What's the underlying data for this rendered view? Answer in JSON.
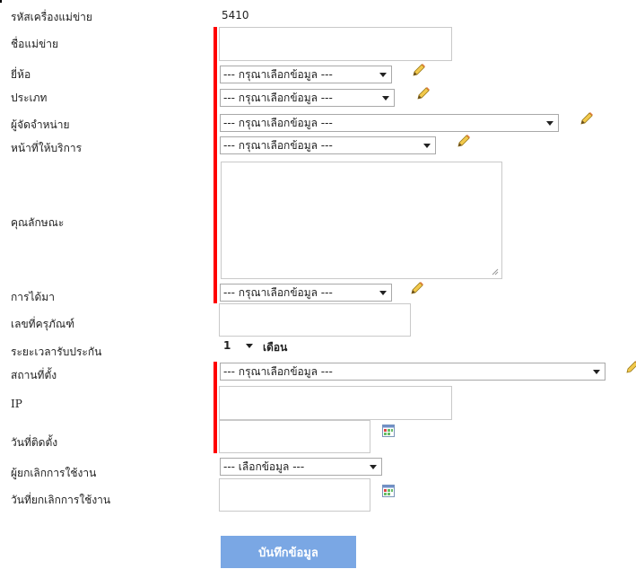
{
  "form": {
    "server_code_label": "รหัสเครื่องแม่ข่าย",
    "server_code_value": "5410",
    "server_name_label": "ชื่อแม่ข่าย",
    "brand_label": "ยี่ห้อ",
    "brand_value": "--- กรุณาเลือกข้อมูล ---",
    "type_label": "ประเภท",
    "type_value": "--- กรุณาเลือกข้อมูล ---",
    "vendor_label": "ผู้จัดจำหน่าย",
    "vendor_value": "--- กรุณาเลือกข้อมูล ---",
    "function_label": "หน้าที่ให้บริการ",
    "function_value": "--- กรุณาเลือกข้อมูล ---",
    "spec_label": "คุณลักษณะ",
    "acquisition_label": "การได้มา",
    "acquisition_value": "--- กรุณาเลือกข้อมูล ---",
    "asset_no_label": "เลขที่ครุภัณฑ์",
    "warranty_label": "ระยะเวลารับประกัน",
    "warranty_value": "1",
    "warranty_unit": "เดือน",
    "location_label": "สถานที่ตั้ง",
    "location_value": "--- กรุณาเลือกข้อมูล ---",
    "ip_label": "IP",
    "install_date_label": "วันที่ติดตั้ง",
    "cancelled_by_label": "ผู้ยกเลิกการใช้งาน",
    "cancelled_by_value": "--- เลือกข้อมูล ---",
    "cancel_date_label": "วันที่ยกเลิกการใช้งาน",
    "save_label": "บันทึกข้อมูล"
  },
  "colors": {
    "required_bar": "#ff0000",
    "save_button": "#7aa7e4"
  },
  "icons": {
    "edit": "pencil-icon",
    "calendar": "calendar-icon"
  }
}
